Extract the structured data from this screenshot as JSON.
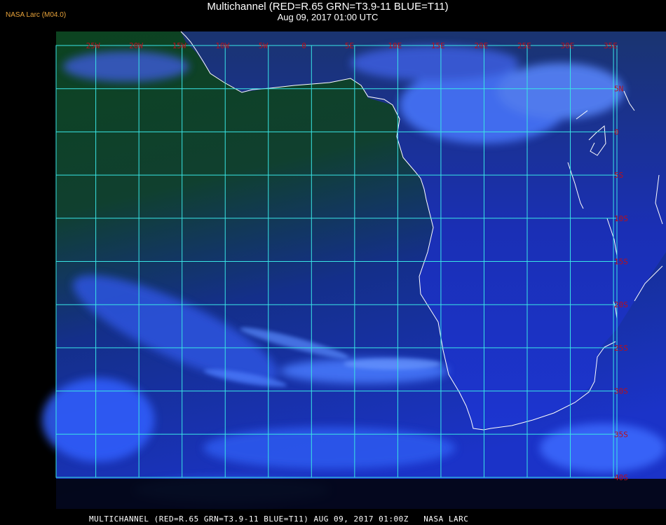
{
  "header": {
    "agency": "NASA Larc (M04.0)",
    "title": "Multichannel (RED=R.65 GRN=T3.9-11 BLUE=T11)",
    "timestamp": "Aug 09, 2017 01:00 UTC"
  },
  "footer": {
    "caption": "MULTICHANNEL (RED=R.65 GRN=T3.9-11 BLUE=T11) AUG 09, 2017 01:00Z   NASA LARC"
  },
  "map": {
    "lon_labels": [
      "25W",
      "20W",
      "15W",
      "10W",
      "5W",
      "0",
      "5E",
      "10E",
      "15E",
      "20E",
      "25E",
      "30E",
      "35E"
    ],
    "lat_labels": [
      "5N",
      "0",
      "5S",
      "10S",
      "15S",
      "20S",
      "25S",
      "30S",
      "35S",
      "40S"
    ],
    "colors": {
      "ocean_dark": "#0b3a1e",
      "ocean_blue": "#1a2fc0",
      "cloud_bright": "#4a7cff",
      "grid": "#39e6e6",
      "label": "#b8101c",
      "coast": "#ffffff"
    }
  }
}
